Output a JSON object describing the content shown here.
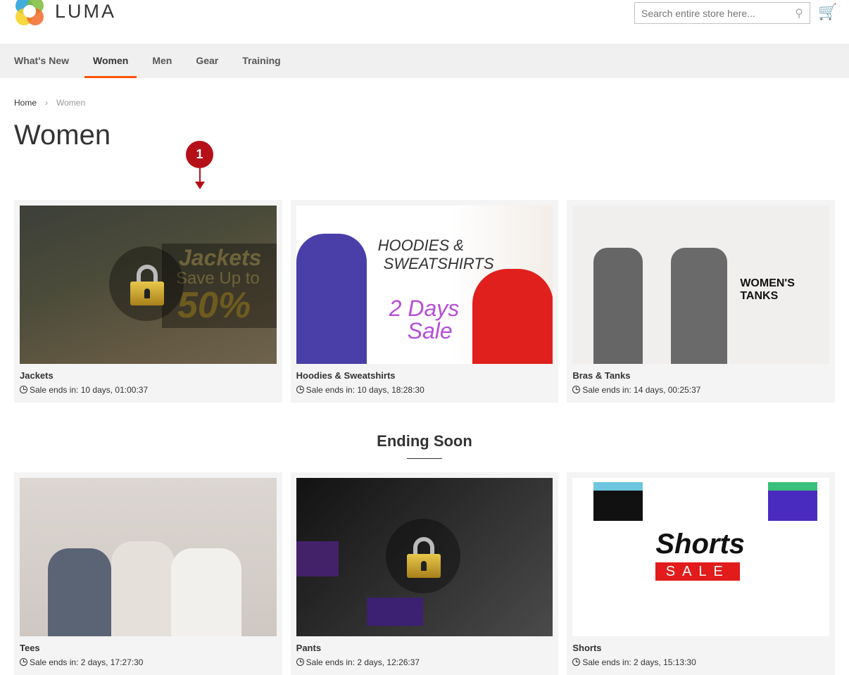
{
  "header": {
    "logo_text": "LUMA",
    "search_placeholder": "Search entire store here..."
  },
  "nav": {
    "items": [
      "What's New",
      "Women",
      "Men",
      "Gear",
      "Training"
    ],
    "active": "Women"
  },
  "breadcrumb": {
    "home": "Home",
    "current": "Women"
  },
  "page_title": "Women",
  "annotation": {
    "marker": "1"
  },
  "section_title": "Ending Soon",
  "cards_top": [
    {
      "title": "Jackets",
      "time": "Sale ends in: 10 days, 01:00:37",
      "locked": true,
      "banner": [
        "Jackets",
        "Save Up to",
        "50%"
      ]
    },
    {
      "title": "Hoodies & Sweatshirts",
      "time": "Sale ends in: 10 days, 18:28:30",
      "locked": false,
      "banner": [
        "HOODIES &",
        "SWEATSHIRTS",
        "2 Days",
        "Sale"
      ]
    },
    {
      "title": "Bras & Tanks",
      "time": "Sale ends in: 14 days, 00:25:37",
      "locked": false,
      "banner": [
        "WOMEN'S TANKS"
      ]
    }
  ],
  "cards_bottom": [
    {
      "title": "Tees",
      "time": "Sale ends in: 2 days, 17:27:30",
      "locked": false
    },
    {
      "title": "Pants",
      "time": "Sale ends in: 2 days, 12:26:37",
      "locked": true
    },
    {
      "title": "Shorts",
      "time": "Sale ends in: 2 days, 15:13:30",
      "locked": false,
      "banner": [
        "Shorts",
        "SALE"
      ]
    }
  ],
  "colors": {
    "accent": "#ff5501",
    "marker": "#b5101a"
  }
}
